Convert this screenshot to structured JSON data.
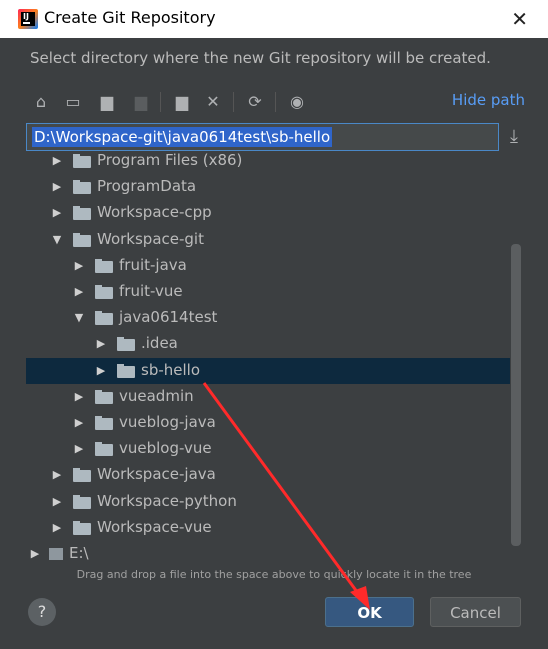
{
  "window": {
    "title": "Create Git Repository",
    "close_glyph": "✕"
  },
  "description": "Select directory where the new Git repository will be created.",
  "toolbar": {
    "buttons": [
      {
        "name": "home-icon",
        "glyph": "⌂",
        "enabled": true
      },
      {
        "name": "desktop-icon",
        "glyph": "▭",
        "enabled": true
      },
      {
        "name": "project-folder-icon",
        "glyph": "▆",
        "enabled": true
      },
      {
        "name": "module-folder-icon",
        "glyph": "▆",
        "enabled": false
      },
      {
        "name": "new-folder-icon",
        "glyph": "▆",
        "enabled": true
      },
      {
        "name": "delete-icon",
        "glyph": "✕",
        "enabled": true
      },
      {
        "name": "refresh-icon",
        "glyph": "⟳",
        "enabled": true
      },
      {
        "name": "show-hidden-icon",
        "glyph": "◉",
        "enabled": true
      }
    ],
    "hide_path_label": "Hide path"
  },
  "path_field": {
    "value": "D:\\Workspace-git\\java0614test\\sb-hello"
  },
  "tree": {
    "items": [
      {
        "label": "Program Files (x86)",
        "depth": 1,
        "expanded": false,
        "selected": false,
        "partial": true
      },
      {
        "label": "ProgramData",
        "depth": 1,
        "expanded": false,
        "selected": false
      },
      {
        "label": "Workspace-cpp",
        "depth": 1,
        "expanded": false,
        "selected": false
      },
      {
        "label": "Workspace-git",
        "depth": 1,
        "expanded": true,
        "selected": false
      },
      {
        "label": "fruit-java",
        "depth": 2,
        "expanded": false,
        "selected": false
      },
      {
        "label": "fruit-vue",
        "depth": 2,
        "expanded": false,
        "selected": false
      },
      {
        "label": "java0614test",
        "depth": 2,
        "expanded": true,
        "selected": false
      },
      {
        "label": ".idea",
        "depth": 3,
        "expanded": false,
        "selected": false
      },
      {
        "label": "sb-hello",
        "depth": 3,
        "expanded": false,
        "selected": true
      },
      {
        "label": "vueadmin",
        "depth": 2,
        "expanded": false,
        "selected": false
      },
      {
        "label": "vueblog-java",
        "depth": 2,
        "expanded": false,
        "selected": false
      },
      {
        "label": "vueblog-vue",
        "depth": 2,
        "expanded": false,
        "selected": false
      },
      {
        "label": "Workspace-java",
        "depth": 1,
        "expanded": false,
        "selected": false
      },
      {
        "label": "Workspace-python",
        "depth": 1,
        "expanded": false,
        "selected": false
      },
      {
        "label": "Workspace-vue",
        "depth": 1,
        "expanded": false,
        "selected": false
      },
      {
        "label": "E:\\",
        "depth": 0,
        "expanded": false,
        "selected": false,
        "drive": true
      }
    ]
  },
  "hint": "Drag and drop a file into the space above to quickly locate it in the tree",
  "footer": {
    "help_glyph": "?",
    "ok_label": "OK",
    "cancel_label": "Cancel"
  },
  "colors": {
    "background": "#3c3f41",
    "selection": "#0d293e",
    "link": "#589df6",
    "annotation_arrow": "#ff2a2a"
  }
}
